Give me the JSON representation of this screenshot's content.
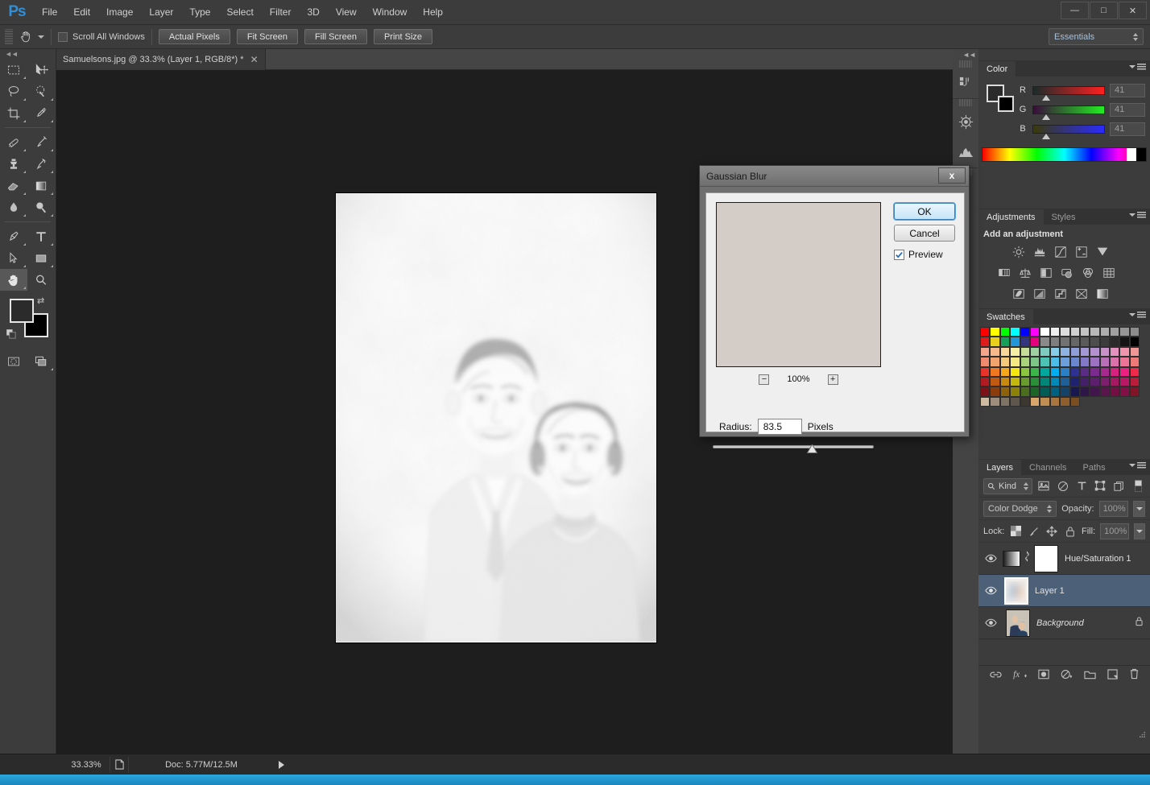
{
  "app": {
    "logo": "Ps",
    "title": "Adobe Photoshop"
  },
  "menubar": {
    "items": [
      "File",
      "Edit",
      "Image",
      "Layer",
      "Type",
      "Select",
      "Filter",
      "3D",
      "View",
      "Window",
      "Help"
    ]
  },
  "window_controls": {
    "minimize": "—",
    "maximize": "□",
    "close": "✕"
  },
  "options_bar": {
    "tool": "hand-tool",
    "scroll_all_windows_label": "Scroll All Windows",
    "scroll_all_windows_checked": false,
    "buttons": [
      "Actual Pixels",
      "Fit Screen",
      "Fill Screen",
      "Print Size"
    ],
    "workspace": "Essentials"
  },
  "toolbar": {
    "tools": [
      {
        "name": "rectangular-marquee-tool",
        "has_flyout": true
      },
      {
        "name": "move-tool",
        "has_flyout": false
      },
      {
        "name": "lasso-tool",
        "has_flyout": true
      },
      {
        "name": "quick-selection-tool",
        "has_flyout": true
      },
      {
        "name": "crop-tool",
        "has_flyout": true
      },
      {
        "name": "eyedropper-tool",
        "has_flyout": true
      },
      {
        "name": "spot-healing-brush-tool",
        "has_flyout": true
      },
      {
        "name": "brush-tool",
        "has_flyout": true
      },
      {
        "name": "clone-stamp-tool",
        "has_flyout": true
      },
      {
        "name": "history-brush-tool",
        "has_flyout": true
      },
      {
        "name": "eraser-tool",
        "has_flyout": true
      },
      {
        "name": "gradient-tool",
        "has_flyout": true
      },
      {
        "name": "blur-tool",
        "has_flyout": true
      },
      {
        "name": "dodge-tool",
        "has_flyout": true
      },
      {
        "name": "pen-tool",
        "has_flyout": true
      },
      {
        "name": "horizontal-type-tool",
        "has_flyout": true
      },
      {
        "name": "path-selection-tool",
        "has_flyout": true
      },
      {
        "name": "rectangle-tool",
        "has_flyout": true
      },
      {
        "name": "hand-tool",
        "has_flyout": true,
        "selected": true
      },
      {
        "name": "zoom-tool",
        "has_flyout": false
      },
      {
        "name": "quick-mask-mode",
        "has_flyout": false
      },
      {
        "name": "screen-mode",
        "has_flyout": false
      }
    ],
    "foreground_color": "#2b2b2b",
    "background_color": "#000000"
  },
  "document_tab": {
    "label": "Samuelsons.jpg @ 33.3% (Layer 1, RGB/8*) *",
    "close": "✕"
  },
  "canvas": {
    "image_description": "high-key pencil-sketch portrait of an elderly couple",
    "background": "#1e1e1e"
  },
  "status_bar": {
    "zoom": "33.33%",
    "doc_label": "Doc: 5.77M/12.5M"
  },
  "dialog": {
    "title": "Gaussian Blur",
    "close": "x",
    "ok_label": "OK",
    "cancel_label": "Cancel",
    "preview_label": "Preview",
    "preview_checked": true,
    "zoom_level": "100%",
    "zoom_out": "−",
    "zoom_in": "+",
    "radius_label": "Radius:",
    "radius_value": "83.5",
    "radius_unit": "Pixels",
    "preview_fill": "#d4ccc6"
  },
  "color_panel": {
    "tab": "Color",
    "channels": [
      {
        "label": "R",
        "value": "41",
        "thumb_pct": 12
      },
      {
        "label": "G",
        "value": "41",
        "thumb_pct": 12
      },
      {
        "label": "B",
        "value": "41",
        "thumb_pct": 12
      }
    ]
  },
  "adjustments_panel": {
    "tabs": [
      "Adjustments",
      "Styles"
    ],
    "active_tab": "Adjustments",
    "heading": "Add an adjustment",
    "rows": [
      [
        "brightness-contrast-icon",
        "levels-icon",
        "curves-icon",
        "exposure-icon",
        "vibrance-icon"
      ],
      [
        "hue-saturation-icon",
        "color-balance-icon",
        "black-white-icon",
        "photo-filter-icon",
        "channel-mixer-icon",
        "color-lookup-icon"
      ],
      [
        "invert-icon",
        "posterize-icon",
        "threshold-icon",
        "selective-color-icon",
        "gradient-map-icon"
      ]
    ]
  },
  "swatches_panel": {
    "tab": "Swatches",
    "colors": [
      "#ff0000",
      "#ffff00",
      "#00ff00",
      "#00ffff",
      "#0000ff",
      "#ff00ff",
      "#ffffff",
      "#ededed",
      "#dcdcdc",
      "#d0d0d0",
      "#c4c4c4",
      "#b8b8b8",
      "#acacac",
      "#a0a0a0",
      "#969696",
      "#8c8c8c",
      "#e01b1b",
      "#e8d01c",
      "#16a05a",
      "#2196d8",
      "#34357f",
      "#e5007e",
      "#8a8a8a",
      "#7e7e7e",
      "#727272",
      "#666666",
      "#5a5a5a",
      "#4e4e4e",
      "#3c3c3c",
      "#2a2a2a",
      "#141414",
      "#000000",
      "#f4a58c",
      "#f5b98c",
      "#f7d79a",
      "#f6eea4",
      "#c6dd9a",
      "#9ed0a2",
      "#7fcdc0",
      "#86cdea",
      "#8fb4e2",
      "#8f9ed8",
      "#a397d4",
      "#b391cf",
      "#c892c9",
      "#e292bd",
      "#f095ab",
      "#f09896",
      "#f08a6e",
      "#f2a46e",
      "#f5c97c",
      "#f4e882",
      "#aad37c",
      "#7ec688",
      "#4dc3b4",
      "#4cbde8",
      "#6ba0dc",
      "#6a86ce",
      "#8377c8",
      "#9d72c0",
      "#b86fb8",
      "#dc70ab",
      "#ee7496",
      "#ee7a78",
      "#e8342b",
      "#f07820",
      "#f5a81c",
      "#f4e70f",
      "#8cc63f",
      "#3cb54a",
      "#00a79d",
      "#00aeef",
      "#2b7fc4",
      "#2e3192",
      "#5b2c86",
      "#7b2a8e",
      "#a62a8e",
      "#d6227f",
      "#ec2081",
      "#ee2a4a",
      "#b01c22",
      "#c05a12",
      "#c68a10",
      "#c4b80c",
      "#6a9b2e",
      "#2a8f38",
      "#008579",
      "#0089b6",
      "#1e5f98",
      "#1f2270",
      "#432068",
      "#5c1f6e",
      "#7e1f6e",
      "#a41960",
      "#b81864",
      "#b81e39",
      "#7c1217",
      "#8a3c0c",
      "#8e620a",
      "#8c8208",
      "#4a6d1e",
      "#1c6526",
      "#005d55",
      "#00607f",
      "#154268",
      "#16184f",
      "#2f1648",
      "#40164c",
      "#59164c",
      "#740f43",
      "#820f46",
      "#821428",
      "#cfbaa2",
      "#9e8d7d",
      "#7e7364",
      "#5f574b",
      "#3c3831",
      "#d9a66c",
      "#c08e52",
      "#a8763e",
      "#8e5f2c",
      "#7a4e20"
    ]
  },
  "layers_panel": {
    "tabs": [
      "Layers",
      "Channels",
      "Paths"
    ],
    "active_tab": "Layers",
    "filter_label": "Kind",
    "blend_mode": "Color Dodge",
    "opacity_label": "Opacity:",
    "opacity_value": "100%",
    "lock_label": "Lock:",
    "fill_label": "Fill:",
    "fill_value": "100%",
    "layers": [
      {
        "name": "Hue/Saturation 1",
        "visible": true,
        "selected": false,
        "italic": false,
        "locked": false,
        "thumb": "adjustment-white",
        "has_mask_link": true
      },
      {
        "name": "Layer 1",
        "visible": true,
        "selected": true,
        "italic": false,
        "locked": false,
        "thumb": "blurred-portrait"
      },
      {
        "name": "Background",
        "visible": true,
        "selected": false,
        "italic": true,
        "locked": true,
        "thumb": "portrait"
      }
    ],
    "footer_icons": [
      "link-layers-icon",
      "layer-style-fx-icon",
      "add-mask-icon",
      "new-adjustment-icon",
      "new-group-icon",
      "new-layer-icon",
      "delete-layer-icon"
    ]
  },
  "rail_icons": [
    "history-actions-icon",
    "navigator-icon",
    "histogram-icon"
  ]
}
